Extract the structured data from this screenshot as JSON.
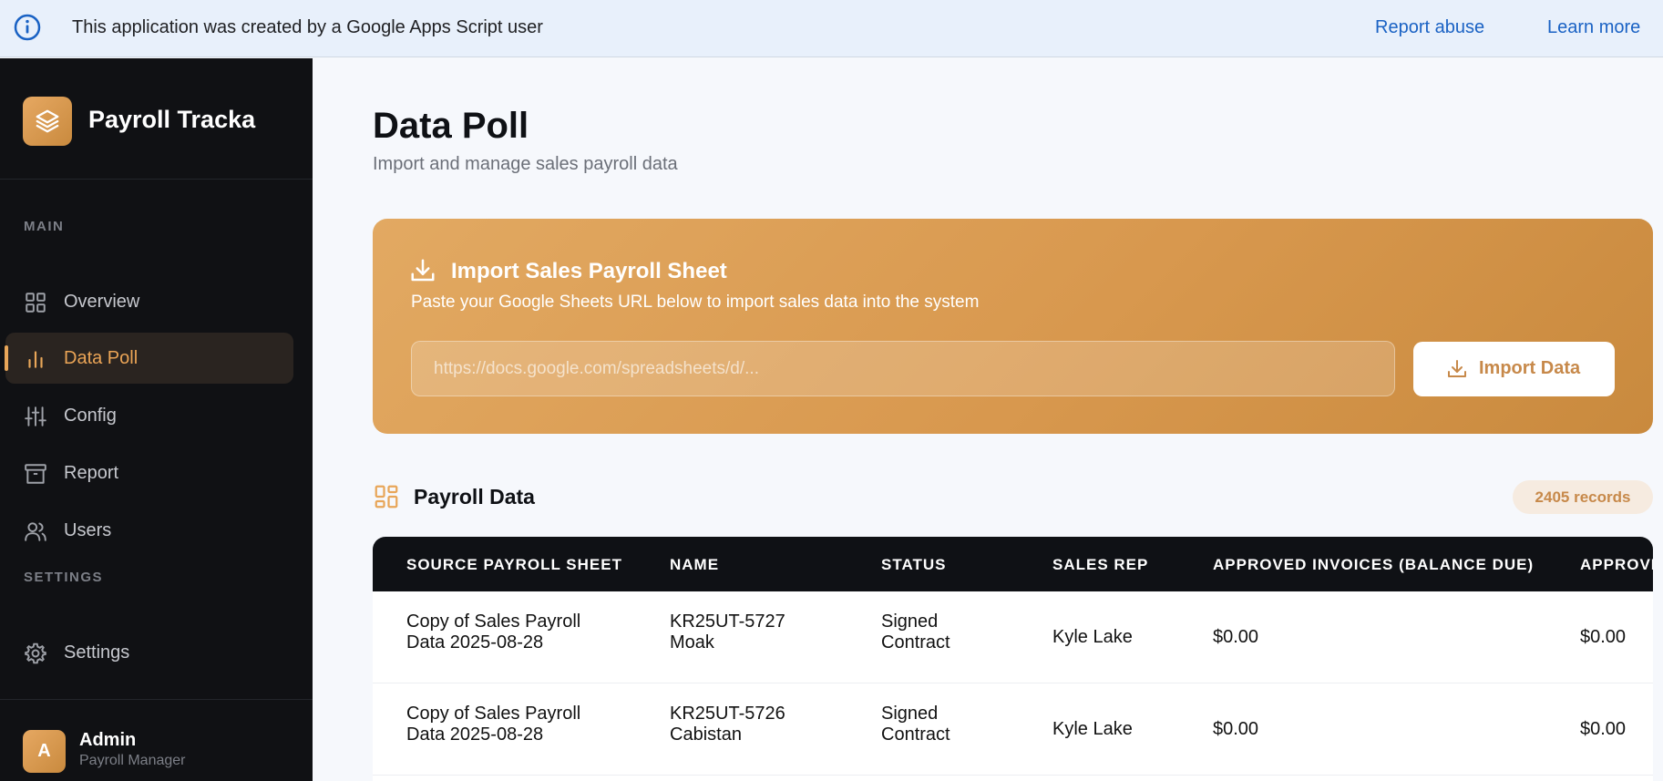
{
  "banner": {
    "message": "This application was created by a Google Apps Script user",
    "report_abuse": "Report abuse",
    "learn_more": "Learn more"
  },
  "sidebar": {
    "app_name": "Payroll Tracka",
    "sections": {
      "main": "MAIN",
      "settings": "SETTINGS"
    },
    "items": [
      {
        "label": "Overview",
        "icon": "grid-icon",
        "active": false
      },
      {
        "label": "Data Poll",
        "icon": "bar-chart-icon",
        "active": true
      },
      {
        "label": "Config",
        "icon": "sliders-icon",
        "active": false
      },
      {
        "label": "Report",
        "icon": "archive-icon",
        "active": false
      },
      {
        "label": "Users",
        "icon": "users-icon",
        "active": false
      }
    ],
    "settings_item": {
      "label": "Settings",
      "icon": "gear-icon"
    },
    "user": {
      "initial": "A",
      "name": "Admin",
      "role": "Payroll Manager"
    }
  },
  "page": {
    "title": "Data Poll",
    "subtitle": "Import and manage sales payroll data"
  },
  "import": {
    "title": "Import Sales Payroll Sheet",
    "description": "Paste your Google Sheets URL below to import sales data into the system",
    "placeholder": "https://docs.google.com/spreadsheets/d/...",
    "button_label": "Import Data"
  },
  "payroll": {
    "title": "Payroll Data",
    "records": "2405 records",
    "columns": [
      "SOURCE PAYROLL SHEET",
      "NAME",
      "STATUS",
      "SALES REP",
      "APPROVED INVOICES (BALANCE DUE)",
      "APPROVED"
    ],
    "rows": [
      {
        "source": [
          "Copy of Sales Payroll",
          "Data 2025-08-28"
        ],
        "name": [
          "KR25UT-5727",
          "Moak"
        ],
        "status": [
          "Signed",
          "Contract"
        ],
        "sales_rep": "Kyle Lake",
        "approved_invoices": "$0.00",
        "approved": "$0.00"
      },
      {
        "source": [
          "Copy of Sales Payroll",
          "Data 2025-08-28"
        ],
        "name": [
          "KR25UT-5726",
          "Cabistan"
        ],
        "status": [
          "Signed",
          "Contract"
        ],
        "sales_rep": "Kyle Lake",
        "approved_invoices": "$0.00",
        "approved": "$0.00"
      }
    ]
  },
  "colors": {
    "accent": "#e8a659",
    "sidebar_bg": "#101114",
    "banner_bg": "#e8f0fb",
    "link": "#1a62c4"
  }
}
